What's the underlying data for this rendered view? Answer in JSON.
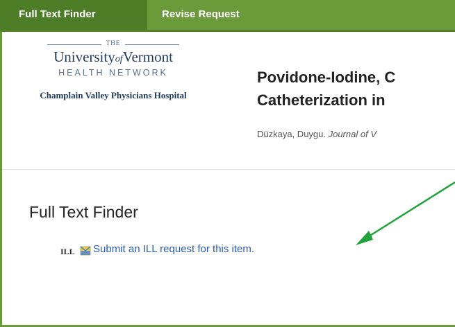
{
  "tabs": [
    {
      "label": "Full Text Finder",
      "active": true
    },
    {
      "label": "Revise Request",
      "active": false
    }
  ],
  "logo": {
    "the": "THE",
    "university_pre": "University",
    "university_of": "of",
    "university_post": "Vermont",
    "health_network": "HEALTH NETWORK",
    "hospital": "Champlain Valley Physicians Hospital"
  },
  "article": {
    "title_line1": "Povidone-Iodine, C",
    "title_line2": "Catheterization in",
    "author": "Düzkaya, Duygu.",
    "journal": "Journal of V"
  },
  "section": {
    "title": "Full Text Finder",
    "ill_icon": "ILL",
    "ill_link": "Submit an ILL request for this item."
  },
  "colors": {
    "bar": "#6b9a3b",
    "active_tab": "#4e7d28",
    "link": "#2b5bb0",
    "annotation_arrow": "#1fa33a"
  }
}
